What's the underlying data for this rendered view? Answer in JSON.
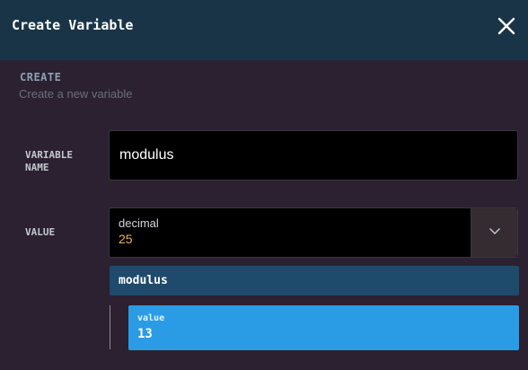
{
  "dialog": {
    "title": "Create Variable",
    "close_icon": "close-icon"
  },
  "section": {
    "title": "CREATE",
    "subtitle": "Create a new variable"
  },
  "form": {
    "name_label": "VARIABLE NAME",
    "name_value": "modulus",
    "value_label": "VALUE",
    "value_type": "decimal",
    "value_number": "25",
    "dropdown_icon": "chevron-down-icon"
  },
  "tree": {
    "parent_label": "modulus",
    "child": {
      "key": "value",
      "value": "13"
    }
  },
  "colors": {
    "header_bg": "#1a3447",
    "body_bg": "#2b2130",
    "value_number": "#e8b357",
    "tree_parent_bg": "#1e4a6b",
    "tree_child_bg": "#2a9ce6"
  }
}
